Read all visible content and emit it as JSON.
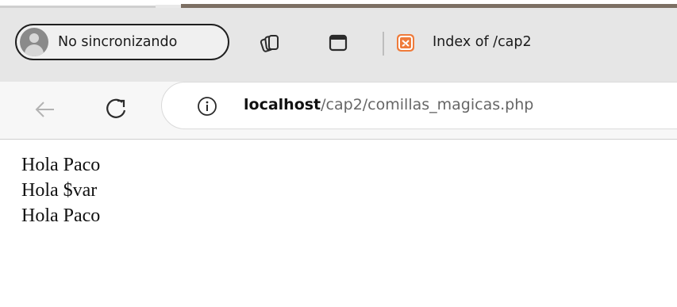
{
  "browser": {
    "profile_label": "No sincronizando",
    "tab": {
      "title": "Index of /cap2"
    },
    "address_bar": {
      "host": "localhost",
      "path": "/cap2/comillas_magicas.php"
    },
    "icons": {
      "profile": "avatar-icon",
      "collections": "collections-icon",
      "tab_actions": "tab-actions-icon",
      "favicon": "xampp-favicon",
      "back": "back-arrow-icon",
      "reload": "reload-icon",
      "site_info": "info-icon"
    }
  },
  "page": {
    "lines": [
      "Hola Paco",
      "Hola $var",
      "Hola Paco"
    ]
  },
  "colors": {
    "tabstrip_bg": "#e6e6e6",
    "toolbar_bg": "#f7f7f7",
    "favicon": "#ef7b3b"
  }
}
